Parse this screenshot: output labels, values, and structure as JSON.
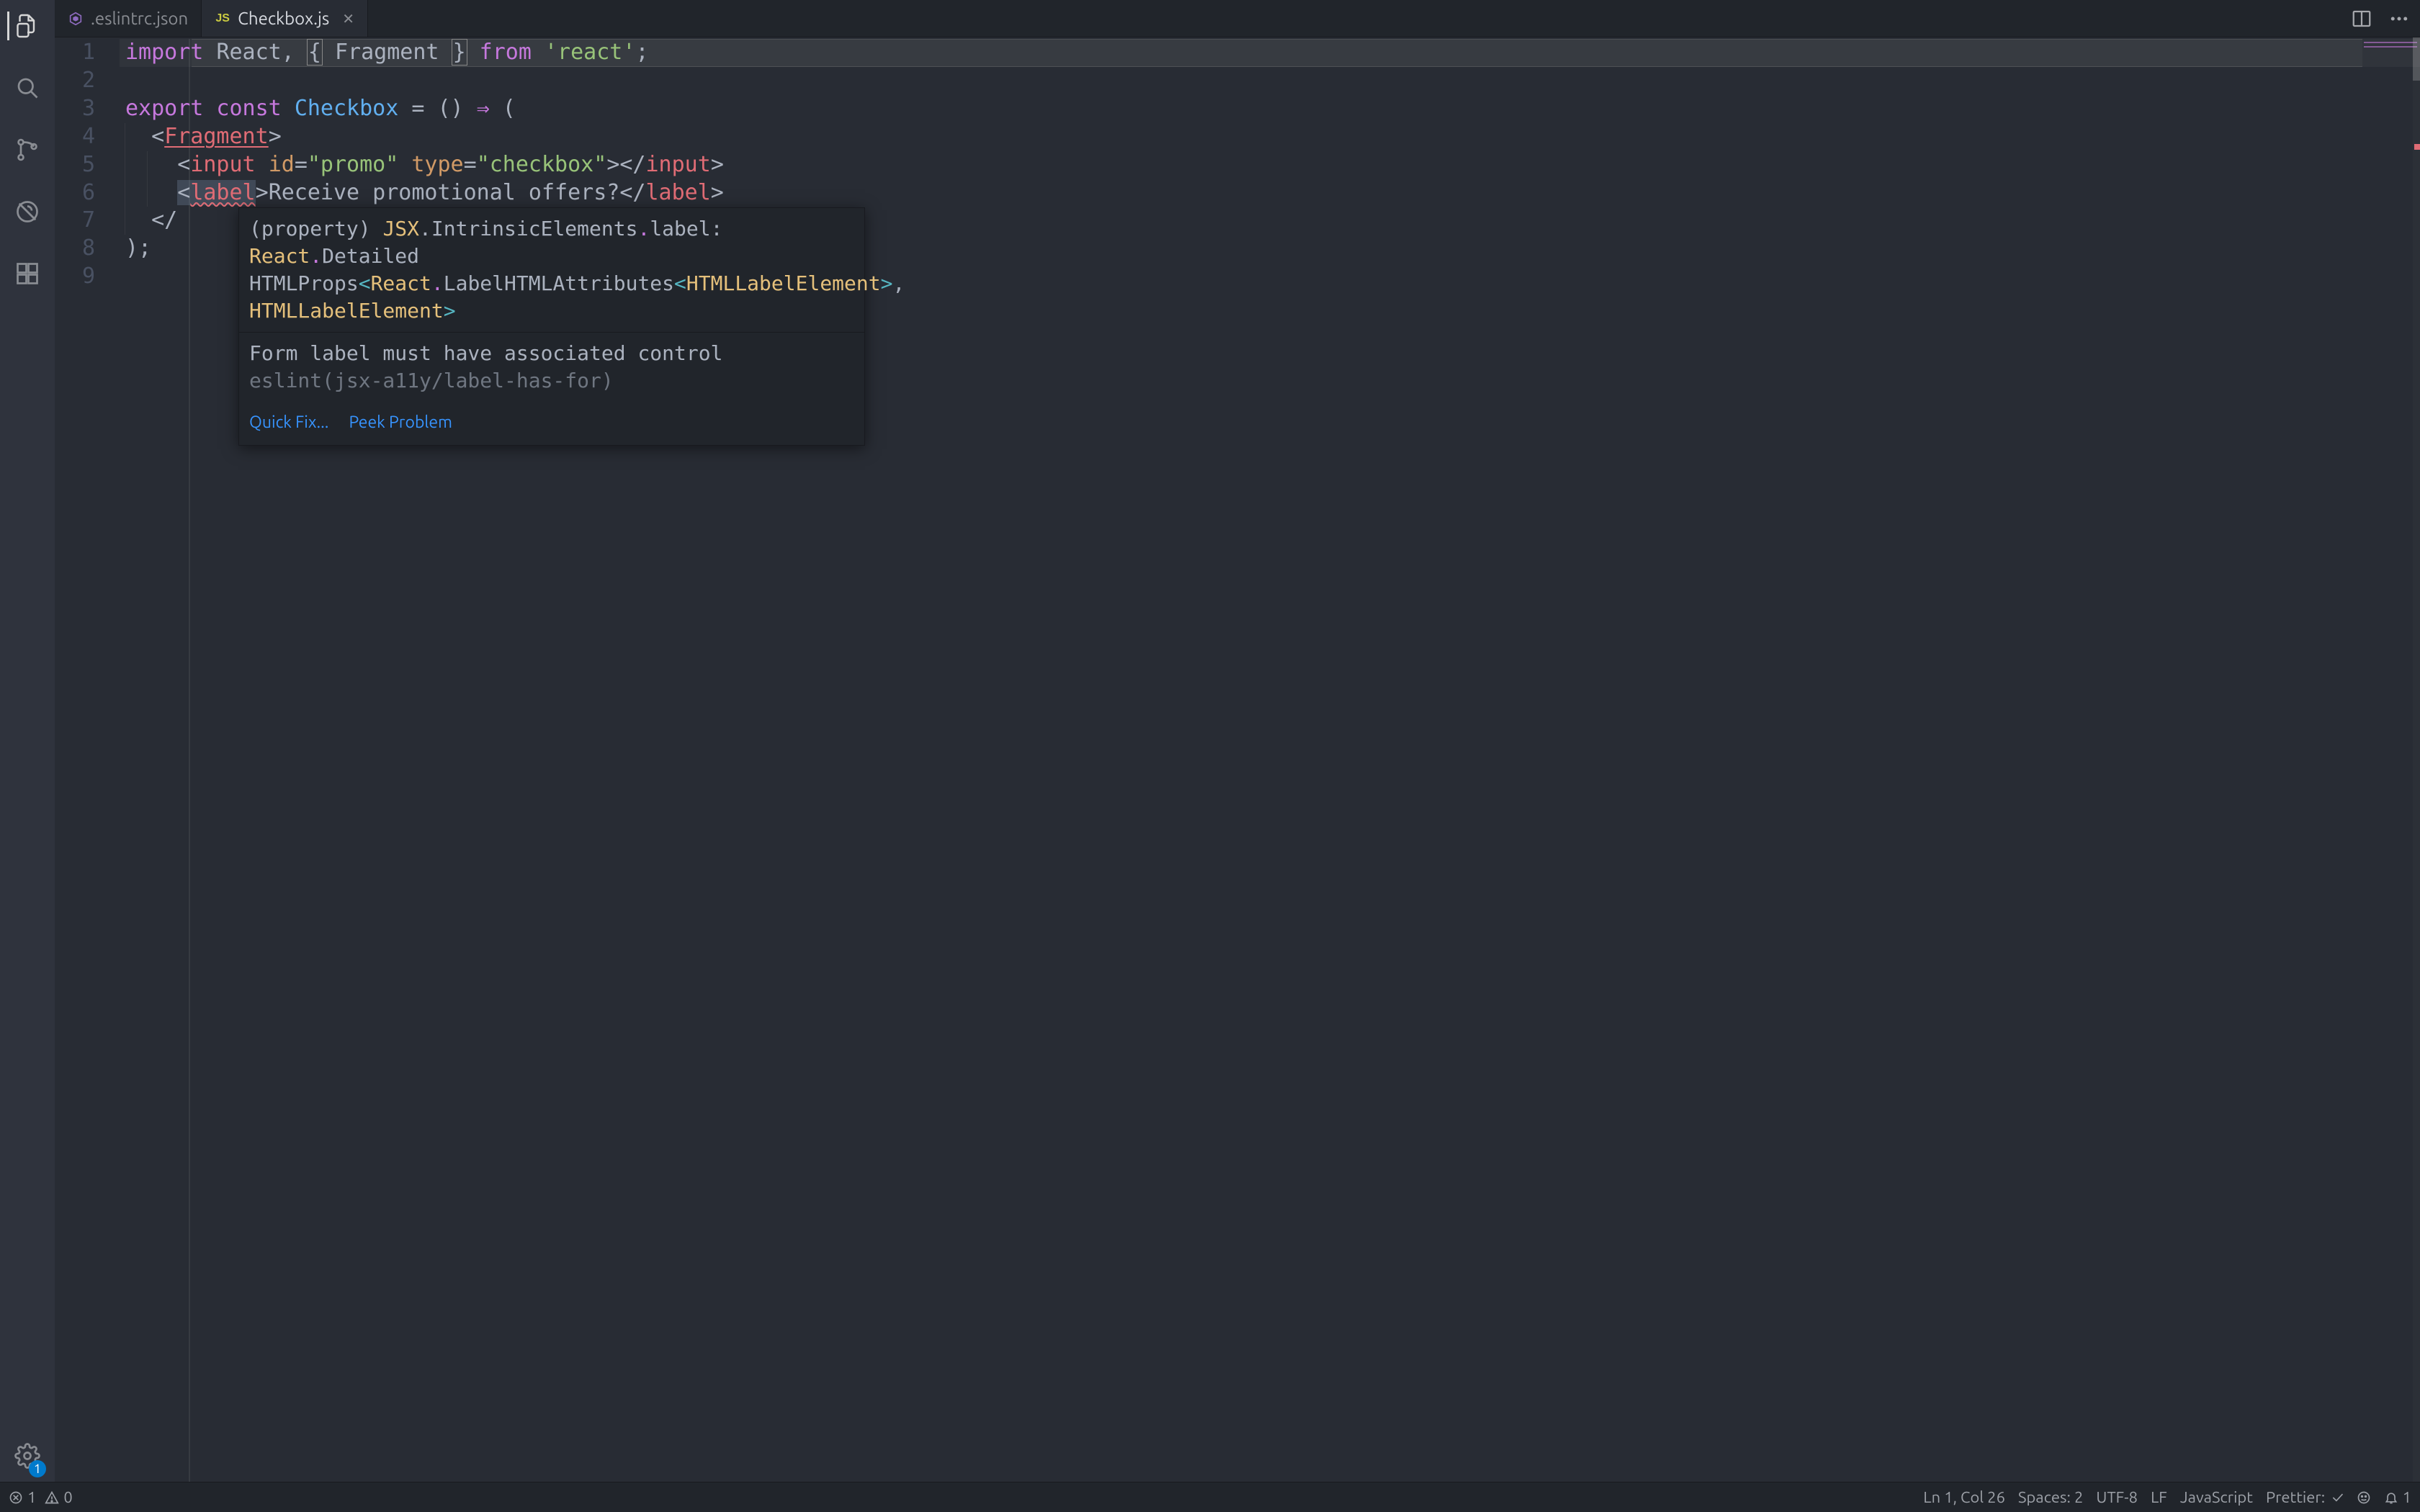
{
  "tabs": [
    {
      "label": ".eslintrc.json",
      "icon": "eslint-file-icon",
      "active": false
    },
    {
      "label": "Checkbox.js",
      "icon": "js-file-icon",
      "active": true
    }
  ],
  "activity_badge": "1",
  "code": {
    "lines": [
      "1",
      "2",
      "3",
      "4",
      "5",
      "6",
      "7",
      "8",
      "9"
    ],
    "l1_import": "import",
    "l1_react": "React",
    "l1_comma": ", ",
    "l1_lbrace": "{",
    "l1_frag": " Fragment ",
    "l1_rbrace": "}",
    "l1_from": " from ",
    "l1_mod": "'react'",
    "l1_semi": ";",
    "l3_export": "export",
    "l3_const": " const ",
    "l3_name": "Checkbox",
    "l3_eq": " = () ",
    "l3_arrow": "⇒",
    "l3_open": " (",
    "l4_open": "<",
    "l4_frag": "Fragment",
    "l4_close": ">",
    "l5_pre": "<",
    "l5_tag": "input",
    "l5_sp1": " ",
    "l5_id_a": "id",
    "l5_eq1": "=",
    "l5_id_v": "\"promo\"",
    "l5_sp2": " ",
    "l5_ty_a": "type",
    "l5_eq2": "=",
    "l5_ty_v": "\"checkbox\"",
    "l5_mid": "></",
    "l5_tag2": "input",
    "l5_end": ">",
    "l6_pre": "<",
    "l6_tag": "label",
    "l6_gt": ">",
    "l6_txt": "Receive promotional offers?",
    "l6_ct": "</",
    "l6_tag2": "label",
    "l6_end": ">",
    "l7_txt": "</",
    "l8_txt": ");"
  },
  "hover": {
    "sig_kind": "(property) ",
    "sig_jsx": "JSX",
    "sig_dot1": ".",
    "sig_intr": "IntrinsicElements",
    "sig_dot2": ".",
    "sig_lbl": "label",
    "sig_colon": ": ",
    "sig_react": "React",
    "sig_dot3": ".",
    "sig_dp": "Detailed",
    "sig_l2a": "HTMLProps",
    "sig_lt": "<",
    "sig_r2": "React",
    "sig_dot4": ".",
    "sig_lha": "LabelHTMLAttributes",
    "sig_lt2": "<",
    "sig_hle": "HTMLLabelElement",
    "sig_gt2": ">",
    "sig_c": ",",
    "sig_l3sp": " ",
    "sig_hle2": "HTMLLabelElement",
    "sig_gt": ">",
    "msg": "Form label must have associated control ",
    "rule": "eslint(jsx-a11y/label-has-for)",
    "quickfix": "Quick Fix...",
    "peek": "Peek Problem"
  },
  "status": {
    "errors": "1",
    "warnings": "0",
    "lncol": "Ln 1, Col 26",
    "spaces": "Spaces: 2",
    "encoding": "UTF-8",
    "eol": "LF",
    "lang": "JavaScript",
    "prettier": "Prettier:",
    "bell": "1"
  }
}
